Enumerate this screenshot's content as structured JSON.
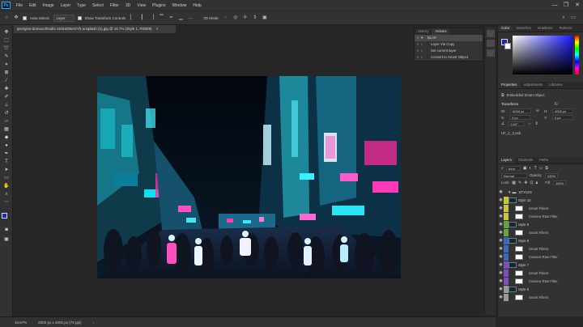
{
  "menubar": {
    "app_icon": "Ps",
    "items": [
      "File",
      "Edit",
      "Image",
      "Layer",
      "Type",
      "Select",
      "Filter",
      "3D",
      "View",
      "Plugins",
      "Window",
      "Help"
    ],
    "window_controls": [
      "—",
      "❐",
      "✕"
    ]
  },
  "options_bar": {
    "auto_select_label": "Auto-Select:",
    "auto_select_value": "Layer",
    "show_transform_label": "Show Transform Controls",
    "mode_label": "3D Mode:"
  },
  "document": {
    "tab_title": "georgios-domouchtsidis-1KhHZWeIVYk-unsplash (1).jpg @ 16.7% (Style 1, RGB/8)",
    "close": "×"
  },
  "status": {
    "zoom": "16.67%",
    "size": "6000 px x 4000 px (72 ppi)"
  },
  "history_panel": {
    "tabs": [
      "History",
      "Actions"
    ],
    "actions": [
      {
        "label": "BLAK",
        "selected": true
      },
      {
        "label": "Layer Via Copy",
        "selected": false
      },
      {
        "label": "Set current layer",
        "selected": false
      },
      {
        "label": "Convert to Smart Object",
        "selected": false
      }
    ]
  },
  "color_panel": {
    "tabs": [
      "Color",
      "Swatches",
      "Gradients",
      "Patterns"
    ],
    "fg": "#1b25d8",
    "bg": "#ffffff"
  },
  "properties_panel": {
    "tabs": [
      "Properties",
      "Adjustments",
      "Libraries"
    ],
    "object_type": "Embedded Smart Object",
    "transform_label": "Transform",
    "w_label": "W:",
    "w_value": "6000 px",
    "h_label": "H:",
    "h_value": "4000 px",
    "x_label": "X:",
    "x_value": "0 px",
    "y_label": "Y:",
    "y_value": "0 px",
    "angle_value": "0.00°",
    "file_name": "HF_C_2.psb"
  },
  "layers_panel": {
    "tabs": [
      "Layers",
      "Channels",
      "Paths"
    ],
    "kind_label": "Kind",
    "blend_mode": "Normal",
    "opacity_label": "Opacity:",
    "opacity_value": "100%",
    "lock_label": "Lock:",
    "fill_label": "Fill:",
    "fill_value": "100%",
    "group_name": "STYLES",
    "rows": [
      {
        "kind": "layer",
        "label": "Style 10",
        "color": "#c9c63a"
      },
      {
        "kind": "sub",
        "label": "Smart Filters",
        "color": "#c9c63a"
      },
      {
        "kind": "sub",
        "label": "Camera Raw Filter",
        "color": "#c9c63a"
      },
      {
        "kind": "layer",
        "label": "Style 9",
        "color": "#6aa33a"
      },
      {
        "kind": "sub",
        "label": "Smart Filters",
        "color": "#6aa33a"
      },
      {
        "kind": "layer",
        "label": "Style 8",
        "color": "#3a6ab8"
      },
      {
        "kind": "sub",
        "label": "Smart Filters",
        "color": "#3a6ab8"
      },
      {
        "kind": "sub",
        "label": "Camera Raw Filter",
        "color": "#3a6ab8"
      },
      {
        "kind": "layer",
        "label": "Style 7",
        "color": "#7d4fb8"
      },
      {
        "kind": "sub",
        "label": "Smart Filters",
        "color": "#7d4fb8"
      },
      {
        "kind": "sub",
        "label": "Camera Raw Filter",
        "color": "#7d4fb8"
      },
      {
        "kind": "layer",
        "label": "Style 6",
        "color": "#999999"
      },
      {
        "kind": "sub",
        "label": "Smart Filters",
        "color": "#999999"
      }
    ]
  }
}
